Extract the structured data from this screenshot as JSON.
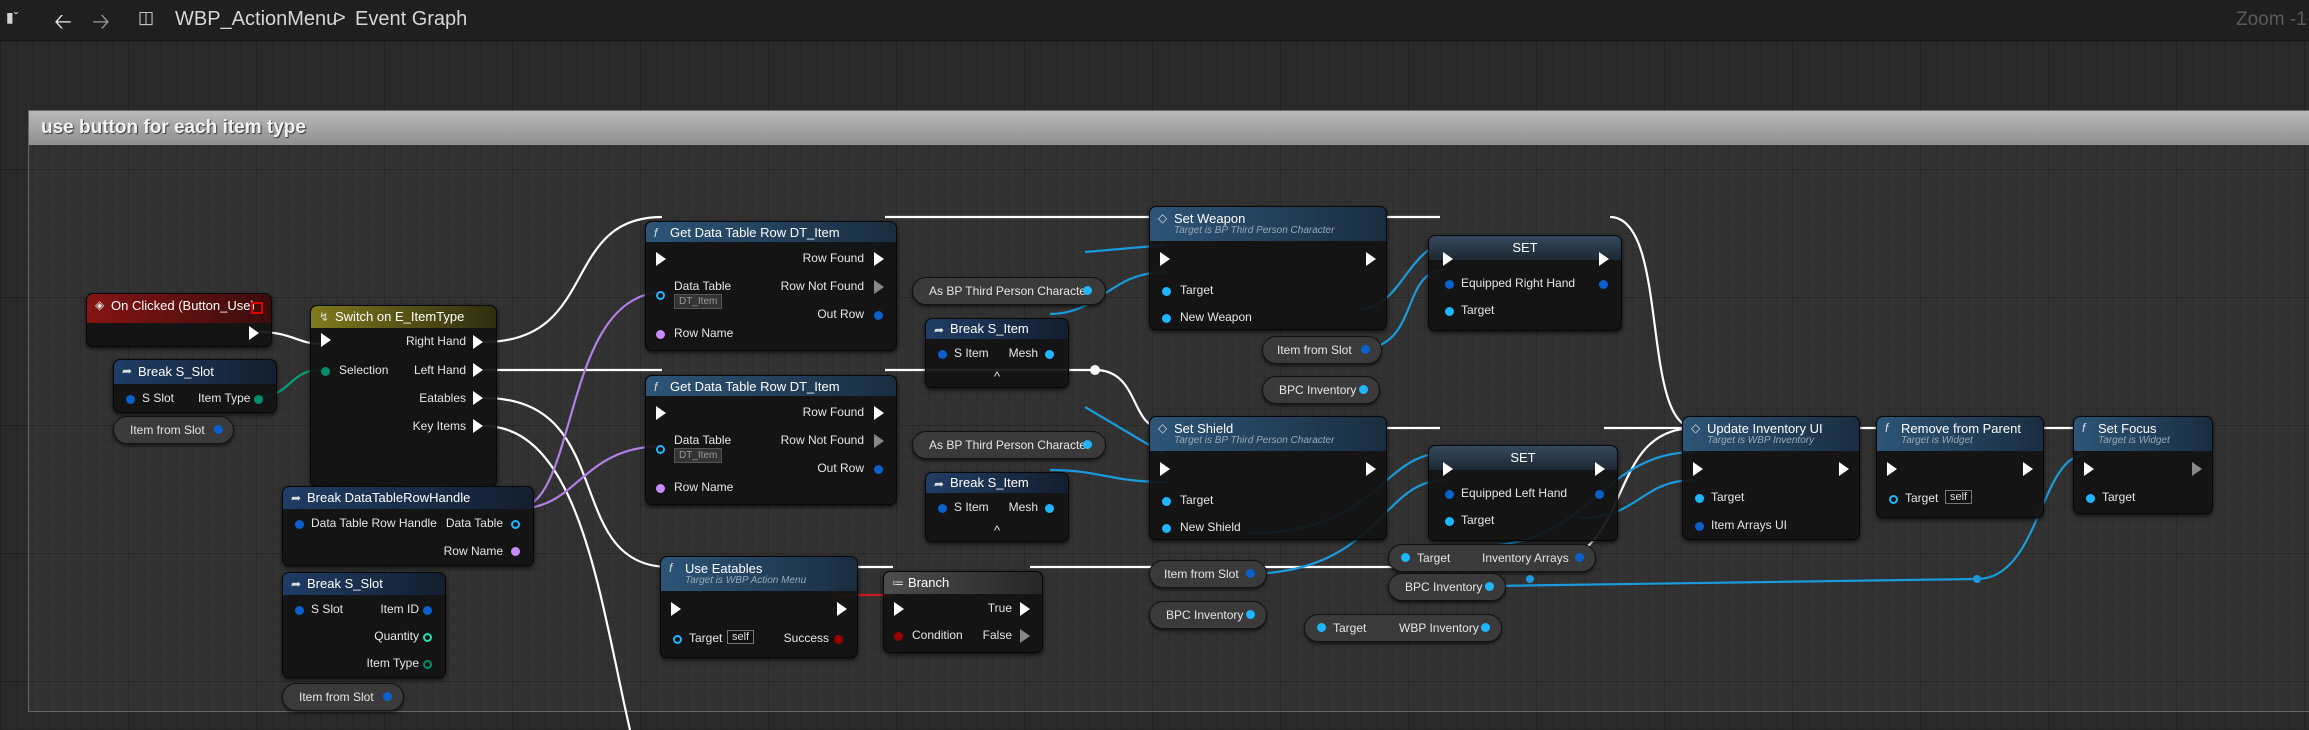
{
  "toolbar": {
    "breadcrumb_blueprint": "WBP_ActionMenu",
    "breadcrumb_separator": ">",
    "breadcrumb_graph": "Event Graph",
    "zoom": "Zoom -1"
  },
  "comment": {
    "title": "use button for each item type"
  },
  "nodes": {
    "on_clicked": {
      "title": "On Clicked (Button_Use)"
    },
    "break_s_slot_1": {
      "title": "Break S_Slot",
      "in_pin": "S Slot",
      "out_pin": "Item Type"
    },
    "item_from_slot_1": {
      "label": "Item from Slot"
    },
    "switch": {
      "title": "Switch on E_ItemType",
      "selection": "Selection",
      "outputs": [
        "Right Hand",
        "Left Hand",
        "Eatables",
        "Key Items"
      ]
    },
    "break_dt_row_handle": {
      "title": "Break DataTableRowHandle",
      "in_pin": "Data Table Row Handle",
      "out_table": "Data Table",
      "out_row": "Row Name"
    },
    "break_s_slot_2": {
      "title": "Break S_Slot",
      "in_pin": "S Slot",
      "outputs": [
        "Item ID",
        "Quantity",
        "Item Type"
      ]
    },
    "item_from_slot_2": {
      "label": "Item from Slot"
    },
    "get_dt_row_1": {
      "title": "Get Data Table Row DT_Item",
      "row_found": "Row Found",
      "row_not_found": "Row Not Found",
      "out_row": "Out Row",
      "data_table": "Data Table",
      "combo": "DT_Item",
      "row_name": "Row Name"
    },
    "get_dt_row_2": {
      "title": "Get Data Table Row DT_Item",
      "row_found": "Row Found",
      "row_not_found": "Row Not Found",
      "out_row": "Out Row",
      "data_table": "Data Table",
      "combo": "DT_Item",
      "row_name": "Row Name"
    },
    "cast_1": {
      "label": "As BP Third Person Character"
    },
    "cast_2": {
      "label": "As BP Third Person Character"
    },
    "break_s_item_1": {
      "title": "Break S_Item",
      "in_pin": "S Item",
      "out_pin": "Mesh",
      "expand": "^"
    },
    "break_s_item_2": {
      "title": "Break S_Item",
      "in_pin": "S Item",
      "out_pin": "Mesh",
      "expand": "^"
    },
    "set_weapon": {
      "title": "Set Weapon",
      "subtitle": "Target is BP Third Person Character",
      "target": "Target",
      "value": "New Weapon"
    },
    "set_shield": {
      "title": "Set Shield",
      "subtitle": "Target is BP Third Person Character",
      "target": "Target",
      "value": "New Shield"
    },
    "item_from_slot_3": {
      "label": "Item from Slot"
    },
    "bpc_inventory_1": {
      "label": "BPC Inventory"
    },
    "item_from_slot_4": {
      "label": "Item from Slot"
    },
    "bpc_inventory_2": {
      "label": "BPC Inventory"
    },
    "set_1": {
      "title": "SET",
      "value": "Equipped Right Hand",
      "target": "Target"
    },
    "set_2": {
      "title": "SET",
      "value": "Equipped Left Hand",
      "target": "Target"
    },
    "target_inventory_arrays": {
      "target": "Target",
      "out": "Inventory Arrays"
    },
    "bpc_inventory_3": {
      "label": "BPC Inventory"
    },
    "target_wbp_inventory": {
      "target": "Target",
      "out": "WBP Inventory"
    },
    "use_eatables": {
      "title": "Use Eatables",
      "subtitle": "Target is WBP Action Menu",
      "target": "Target",
      "self": "self",
      "success": "Success"
    },
    "branch": {
      "title": "Branch",
      "condition": "Condition",
      "true": "True",
      "false": "False"
    },
    "update_inventory_ui": {
      "title": "Update Inventory UI",
      "subtitle": "Target is WBP Inventory",
      "target": "Target",
      "arrays": "Item Arrays UI"
    },
    "remove_from_parent": {
      "title": "Remove from Parent",
      "subtitle": "Target is Widget",
      "target": "Target",
      "self": "self"
    },
    "set_focus": {
      "title": "Set Focus",
      "subtitle": "Target is Widget",
      "target": "Target"
    }
  },
  "colors": {
    "exec": "#ffffff",
    "object_pin": "#1eb6ff",
    "struct_pin": "#0a61cc",
    "name_pin": "#c88cff",
    "enum_pin": "#008f6b",
    "bool_pin": "#9a0000",
    "event_header": "#861414",
    "function_header": "#2c5578"
  }
}
